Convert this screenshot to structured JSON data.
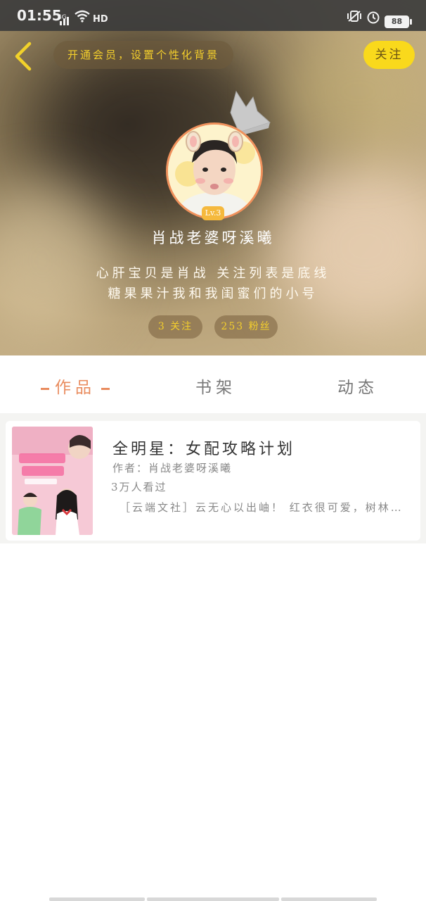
{
  "status_bar": {
    "time": "01:55",
    "network": "4G",
    "hd": "HD",
    "battery": "88"
  },
  "header": {
    "vip_banner": "开通会员，设置个性化背景",
    "follow_button": "关注",
    "level": "Lv.3",
    "username": "肖战老婆呀溪曦",
    "bio_line1": "心肝宝贝是肖战 关注列表是底线",
    "bio_line2": "糖果果汁我和我闺蜜们的小号",
    "following": "3 关注",
    "fans": "253 粉丝"
  },
  "tabs": [
    {
      "label": "作品",
      "active": true
    },
    {
      "label": "书架",
      "active": false
    },
    {
      "label": "动态",
      "active": false
    }
  ],
  "works": [
    {
      "title": "全明星：女配攻略计划",
      "author": "作者：肖战老婆呀溪曦",
      "views": "3万人看过",
      "description": "［云端文社］云无心以出岫！ 红衣很可爱，树林里的故事"
    }
  ],
  "colors": {
    "accent_orange": "#e98c5f",
    "vip_yellow": "#f9d91c",
    "badge_gold": "#f5b93d"
  }
}
